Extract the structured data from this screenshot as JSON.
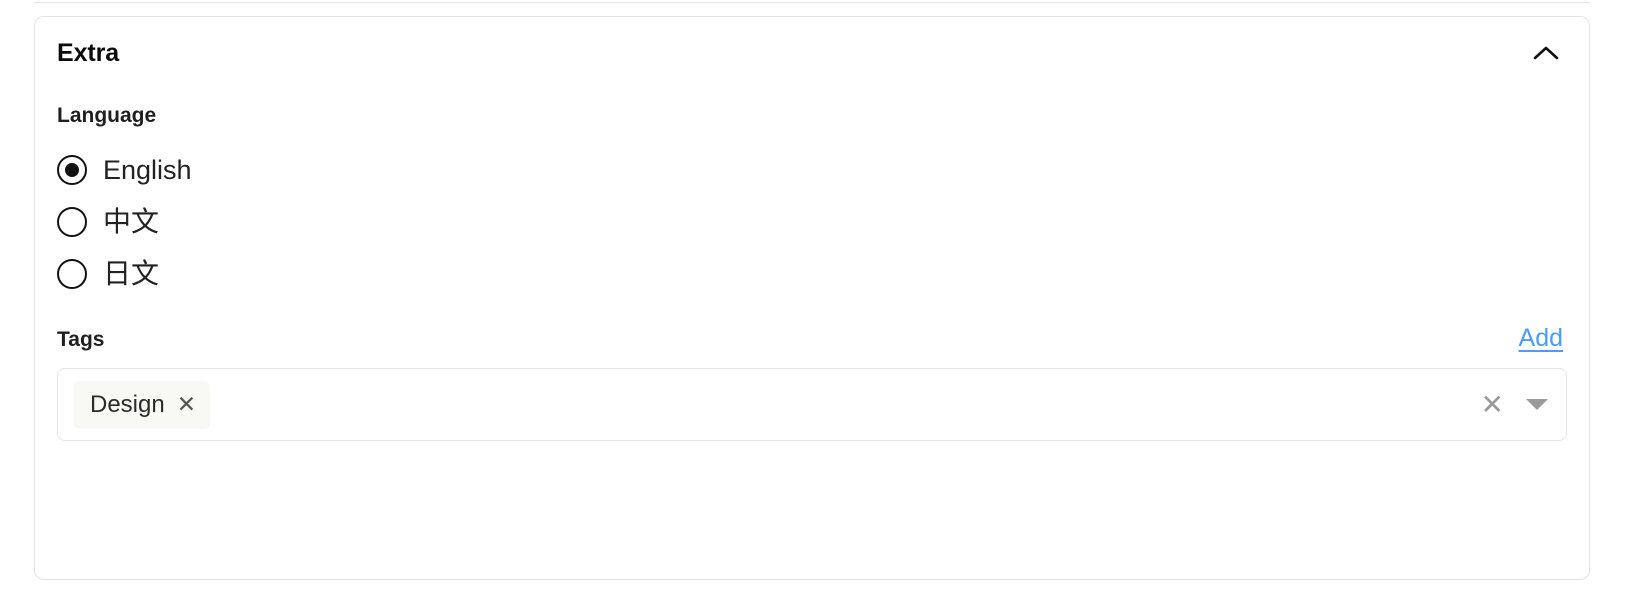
{
  "card": {
    "title": "Extra",
    "collapse_icon": "chevron-up-icon"
  },
  "language": {
    "label": "Language",
    "options": [
      {
        "label": "English",
        "selected": true
      },
      {
        "label": "中文",
        "selected": false
      },
      {
        "label": "日文",
        "selected": false
      }
    ]
  },
  "tags": {
    "label": "Tags",
    "add_label": "Add",
    "chips": [
      {
        "label": "Design",
        "remove_glyph": "✕"
      }
    ],
    "clear_glyph": "✕",
    "dropdown_icon": "caret-down-icon"
  },
  "colors": {
    "link": "#4a9bff",
    "border": "#e3e3e3",
    "chip_bg": "#f8f8f4",
    "icon_muted": "#9a9a9a"
  }
}
